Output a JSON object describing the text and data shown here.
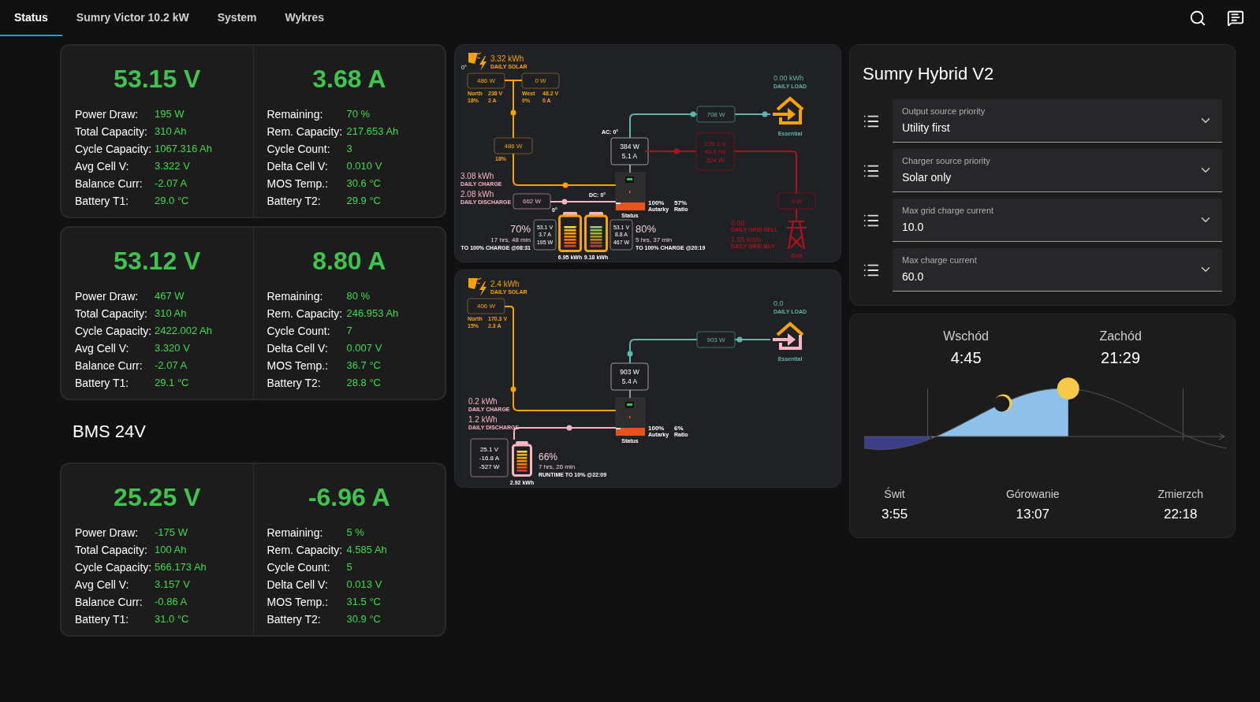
{
  "tabs": [
    {
      "label": "Status",
      "selected": true
    },
    {
      "label": "Sumry Victor 10.2 kW",
      "selected": false
    },
    {
      "label": "System",
      "selected": false
    },
    {
      "label": "Wykres",
      "selected": false
    }
  ],
  "bms": [
    {
      "kind": "card",
      "left": {
        "value": "53.15 V",
        "rows": [
          {
            "label": "Power Draw:",
            "value": "195 W"
          },
          {
            "label": "Total Capacity:",
            "value": "310 Ah"
          },
          {
            "label": "Cycle Capacity:",
            "value": "1067.316 Ah"
          },
          {
            "label": "Avg Cell V:",
            "value": "3.322 V"
          },
          {
            "label": "Balance Curr:",
            "value": "-2.07 A"
          },
          {
            "label": "Battery T1:",
            "value": "29.0 °C"
          }
        ]
      },
      "right": {
        "value": "3.68 A",
        "rows": [
          {
            "label": "Remaining:",
            "value": "70 %"
          },
          {
            "label": "Rem. Capacity:",
            "value": "217.653 Ah"
          },
          {
            "label": "Cycle Count:",
            "value": "3"
          },
          {
            "label": "Delta Cell V:",
            "value": "0.010 V"
          },
          {
            "label": "MOS Temp.:",
            "value": "30.6 °C"
          },
          {
            "label": "Battery T2:",
            "value": "29.9 °C"
          }
        ]
      }
    },
    {
      "kind": "card",
      "left": {
        "value": "53.12 V",
        "rows": [
          {
            "label": "Power Draw:",
            "value": "467 W"
          },
          {
            "label": "Total Capacity:",
            "value": "310 Ah"
          },
          {
            "label": "Cycle Capacity:",
            "value": "2422.002 Ah"
          },
          {
            "label": "Avg Cell V:",
            "value": "3.320 V"
          },
          {
            "label": "Balance Curr:",
            "value": "-2.07 A"
          },
          {
            "label": "Battery T1:",
            "value": "29.1 °C"
          }
        ]
      },
      "right": {
        "value": "8.80 A",
        "rows": [
          {
            "label": "Remaining:",
            "value": "80 %"
          },
          {
            "label": "Rem. Capacity:",
            "value": "246.953 Ah"
          },
          {
            "label": "Cycle Count:",
            "value": "7"
          },
          {
            "label": "Delta Cell V:",
            "value": "0.007 V"
          },
          {
            "label": "MOS Temp.:",
            "value": "36.7 °C"
          },
          {
            "label": "Battery T2:",
            "value": "28.8 °C"
          }
        ]
      }
    },
    {
      "kind": "heading",
      "text": "BMS 24V"
    },
    {
      "kind": "card",
      "left": {
        "value": "25.25 V",
        "rows": [
          {
            "label": "Power Draw:",
            "value": "-175 W"
          },
          {
            "label": "Total Capacity:",
            "value": "100 Ah"
          },
          {
            "label": "Cycle Capacity:",
            "value": "566.173 Ah"
          },
          {
            "label": "Avg Cell V:",
            "value": "3.157 V"
          },
          {
            "label": "Balance Curr:",
            "value": "-0.86 A"
          },
          {
            "label": "Battery T1:",
            "value": "31.0 °C"
          }
        ]
      },
      "right": {
        "value": "-6.96 A",
        "rows": [
          {
            "label": "Remaining:",
            "value": "5 %"
          },
          {
            "label": "Rem. Capacity:",
            "value": "4.585 Ah"
          },
          {
            "label": "Cycle Count:",
            "value": "5"
          },
          {
            "label": "Delta Cell V:",
            "value": "0.013 V"
          },
          {
            "label": "MOS Temp.:",
            "value": "31.5 °C"
          },
          {
            "label": "Battery T2:",
            "value": "30.9 °C"
          }
        ]
      }
    }
  ],
  "flows": [
    {
      "solar": {
        "energy": "3.32 kWh",
        "label": "DAILY SOLAR",
        "angle": "0°",
        "strings": [
          {
            "power": "486 W",
            "name": "North",
            "voltage": "238 V",
            "percent": "18%",
            "current": "2 A"
          },
          {
            "power": "0 W",
            "name": "West",
            "voltage": "48.2 V",
            "percent": "0%",
            "current": "0 A"
          }
        ],
        "total": {
          "power": "486 W",
          "percent": "18%"
        }
      },
      "inverter": {
        "ac_label": "AC: 0°",
        "power": "384 W",
        "current": "5.1 A",
        "dc_label": "DC: 0°",
        "status": "Status"
      },
      "load": {
        "energy": "0.00 kWh",
        "label": "DAILY LOAD",
        "power": "708 W",
        "name": "Essential"
      },
      "grid": {
        "voltage": "239.1 V",
        "frequency": "49.9 Hz",
        "power": "324 W",
        "grid_power": "0 W",
        "sell": "0.00",
        "sell_label": "DAILY GRID SELL",
        "buy": "1.85 kWh",
        "buy_label": "DAILY GRID BUY",
        "name": "Grid"
      },
      "battery": {
        "charge": "3.08 kWh",
        "charge_label": "DAILY CHARGE",
        "discharge": "2.08 kWh",
        "discharge_label": "DAILY DISCHARGE",
        "power": "662 W",
        "angle": "0°",
        "packs": [
          {
            "soc": "70%",
            "time": "17 hrs, 48 min",
            "note": "TO 100% CHARGE @08:31",
            "voltage": "53.1 V",
            "current": "3.7 A",
            "power": "195 W",
            "energy": "6.95 kWh"
          },
          {
            "soc": "80%",
            "time": "5 hrs, 37 min",
            "note": "TO 100% CHARGE @20:19",
            "voltage": "53.1 V",
            "current": "8.8 A",
            "power": "467 W",
            "energy": "9.18 kWh"
          }
        ]
      },
      "autarky": {
        "value": "100%",
        "label": "Autarky"
      },
      "ratio": {
        "value": "57%",
        "label": "Ratio"
      }
    },
    {
      "solar": {
        "energy": "2.4 kWh",
        "label": "DAILY SOLAR",
        "strings": [
          {
            "power": "406 W",
            "name": "North",
            "voltage": "170.3 V",
            "percent": "15%",
            "current": "2.3 A"
          }
        ]
      },
      "inverter": {
        "power": "903 W",
        "current": "5.4 A",
        "status": "Status"
      },
      "load": {
        "energy": "0.0",
        "label": "DAILY LOAD",
        "power": "903 W",
        "name": "Essential"
      },
      "battery": {
        "charge": "0.2 kWh",
        "charge_label": "DAILY CHARGE",
        "discharge": "1.2 kWh",
        "discharge_label": "DAILY DISCHARGE",
        "packs": [
          {
            "soc": "66%",
            "time": "7 hrs, 26 min",
            "note": "RUNTIME TO 10% @22:09",
            "voltage": "25.1 V",
            "current": "-16.8 A",
            "power": "-527 W",
            "energy": "2.92 kWh"
          }
        ]
      },
      "autarky": {
        "value": "100%",
        "label": "Autarky"
      },
      "ratio": {
        "value": "6%",
        "label": "Ratio"
      }
    }
  ],
  "hybrid": {
    "title": "Sumry Hybrid V2",
    "selects": [
      {
        "label": "Output source priority",
        "value": "Utility first"
      },
      {
        "label": "Charger source priority",
        "value": "Solar only"
      },
      {
        "label": "Max grid charge current",
        "value": "10.0"
      },
      {
        "label": "Max charge current",
        "value": "60.0"
      }
    ]
  },
  "sun": {
    "rise": {
      "label": "Wschód",
      "time": "4:45"
    },
    "set": {
      "label": "Zachód",
      "time": "21:29"
    },
    "events": [
      {
        "label": "Świt",
        "time": "3:55"
      },
      {
        "label": "Górowanie",
        "time": "13:07"
      },
      {
        "label": "Zmierzch",
        "time": "22:18"
      }
    ]
  }
}
